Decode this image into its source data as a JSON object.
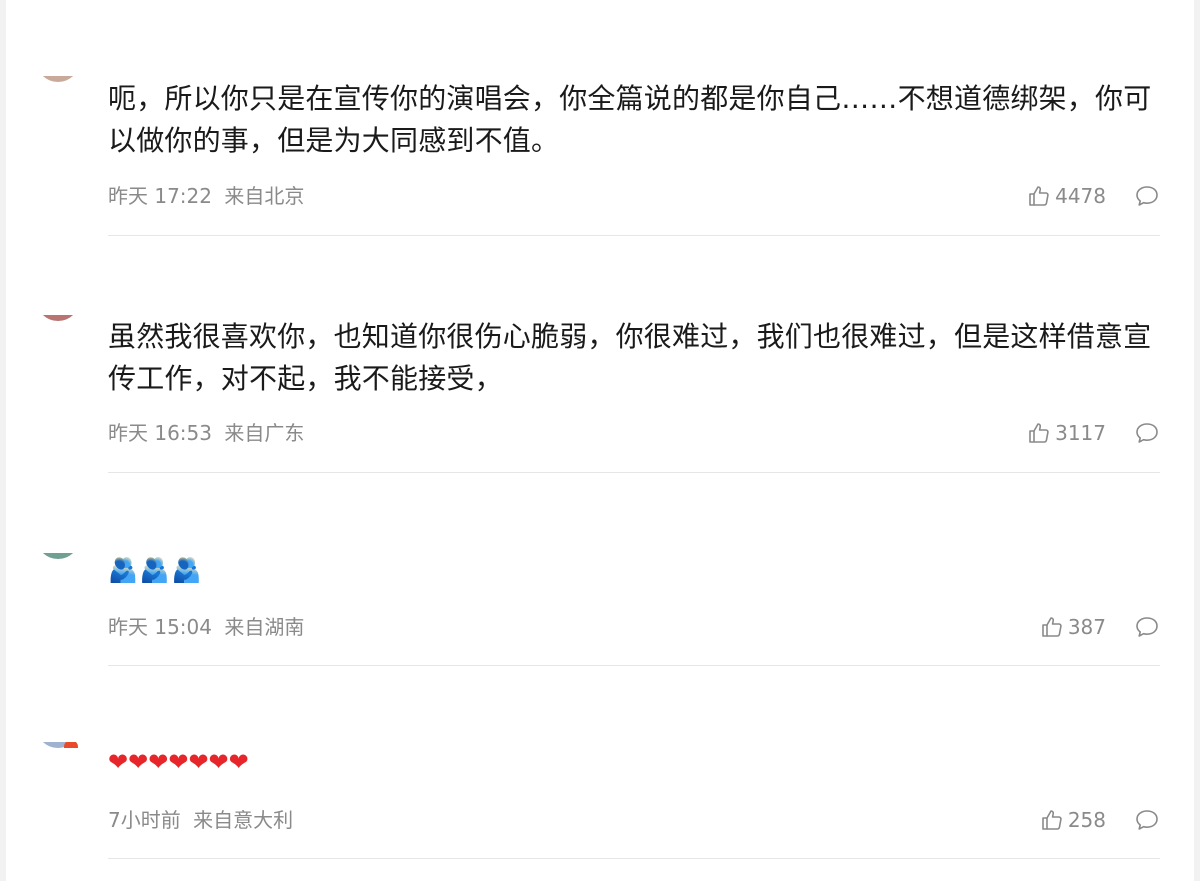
{
  "comments": [
    {
      "text": "呃，所以你只是在宣传你的演唱会，你全篇说的都是你自己……不想道德绑架，你可以做你的事，但是为大同感到不值。",
      "time": "昨天 17:22",
      "location": "来自北京",
      "likes": "4478",
      "avatar_color": "#c9a99a"
    },
    {
      "text": "虽然我很喜欢你，也知道你很伤心脆弱，你很难过，我们也很难过，但是这样借意宣传工作，对不起，我不能接受，",
      "time": "昨天 16:53",
      "location": "来自广东",
      "likes": "3117",
      "avatar_color": "#b87470"
    },
    {
      "text": "🫂🫂🫂",
      "time": "昨天 15:04",
      "location": "来自湖南",
      "likes": "387",
      "avatar_color": "#6fa091"
    },
    {
      "text": "❤❤❤❤❤❤❤",
      "time": "7小时前",
      "location": "来自意大利",
      "likes": "258",
      "avatar_color": "#9fb2cf"
    }
  ],
  "icons": {
    "like": "thumbs-up-icon",
    "reply": "comment-bubble-icon"
  }
}
